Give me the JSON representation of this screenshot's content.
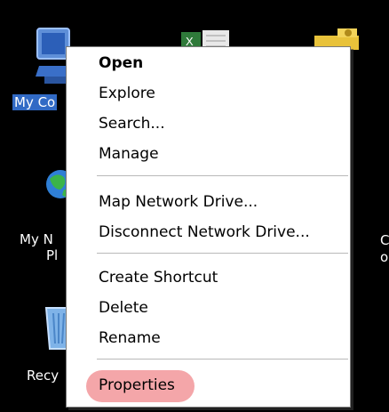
{
  "desktop": {
    "icons": [
      {
        "name": "my-computer",
        "label": "My Co"
      },
      {
        "name": "my-network-places",
        "label_line1": "My N",
        "label_line2": "Pl"
      },
      {
        "name": "recycle-bin",
        "label": "Recy"
      },
      {
        "name": "spreadsheet",
        "label": ""
      },
      {
        "name": "key-folder",
        "label": ""
      },
      {
        "name": "right-fragment",
        "label_line1": "C",
        "label_line2": "o"
      }
    ]
  },
  "context_menu": {
    "items": [
      {
        "label": "Open",
        "bold": true
      },
      {
        "label": "Explore"
      },
      {
        "label": "Search..."
      },
      {
        "label": "Manage"
      },
      {
        "label": "Map Network Drive..."
      },
      {
        "label": "Disconnect Network Drive..."
      },
      {
        "label": "Create Shortcut"
      },
      {
        "label": "Delete"
      },
      {
        "label": "Rename"
      },
      {
        "label": "Properties",
        "highlighted": true
      }
    ],
    "highlight_color": "#f4a6a9"
  },
  "colors": {
    "desktop_bg": "#000000",
    "selection": "#316ac5",
    "menu_bg": "#ffffff",
    "separator": "#b9b9b9"
  }
}
